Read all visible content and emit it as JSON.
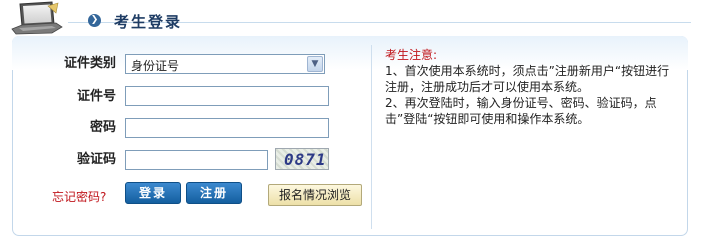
{
  "header": {
    "title": "考生登录",
    "arrow_icon": "circle-arrow-icon",
    "logo_icon": "laptop-icon"
  },
  "form": {
    "id_type_label": "证件类别",
    "id_type_value": "身份证号",
    "id_number_label": "证件号",
    "id_number_value": "",
    "password_label": "密码",
    "password_value": "",
    "captcha_label": "验证码",
    "captcha_value": "",
    "captcha_code": "0871",
    "forgot_password": "忘记密码?",
    "login_button": "登录",
    "register_button": "注册",
    "browse_button": "报名情况浏览"
  },
  "notice": {
    "title": "考生注意:",
    "line1": "1、首次使用本系统时，须点击”注册新用户“按钮进行注册，注册成功后才可以使用本系统。",
    "line2": "2、再次登陆时，输入身份证号、密码、验证码，点击”登陆“按钮即可使用和操作本系统。"
  },
  "colors": {
    "accent": "#1e3c64",
    "button": "#1f6fb4",
    "notice_title": "#c0161c",
    "panel_border": "#c3d7ea"
  }
}
